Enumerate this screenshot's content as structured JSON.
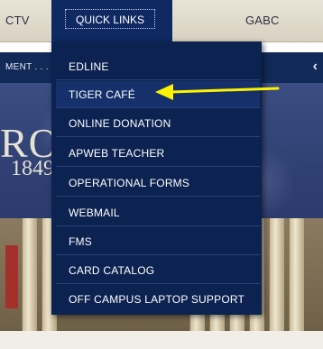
{
  "nav": {
    "item_left": "CTV",
    "quick_links": "QUICK LINKS",
    "item_right": "GABC"
  },
  "subnav": {
    "text": "MENT . . .",
    "chevron": "‹"
  },
  "hero": {
    "big_text": "ROS",
    "year_text": "1849"
  },
  "dropdown": {
    "items": [
      {
        "label": "EDLINE"
      },
      {
        "label": "TIGER CAFÉ"
      },
      {
        "label": "ONLINE DONATION"
      },
      {
        "label": "APWEB TEACHER"
      },
      {
        "label": "OPERATIONAL FORMS"
      },
      {
        "label": "WEBMAIL"
      },
      {
        "label": "FMS"
      },
      {
        "label": "CARD CATALOG"
      },
      {
        "label": "OFF CAMPUS LAPTOP SUPPORT"
      }
    ]
  },
  "annotation": {
    "arrow_color": "#fff200"
  },
  "colors": {
    "menu_bg": "#0c2250",
    "nav_bg": "#e8e3d6",
    "quick_links_bg": "#0f2a63"
  }
}
